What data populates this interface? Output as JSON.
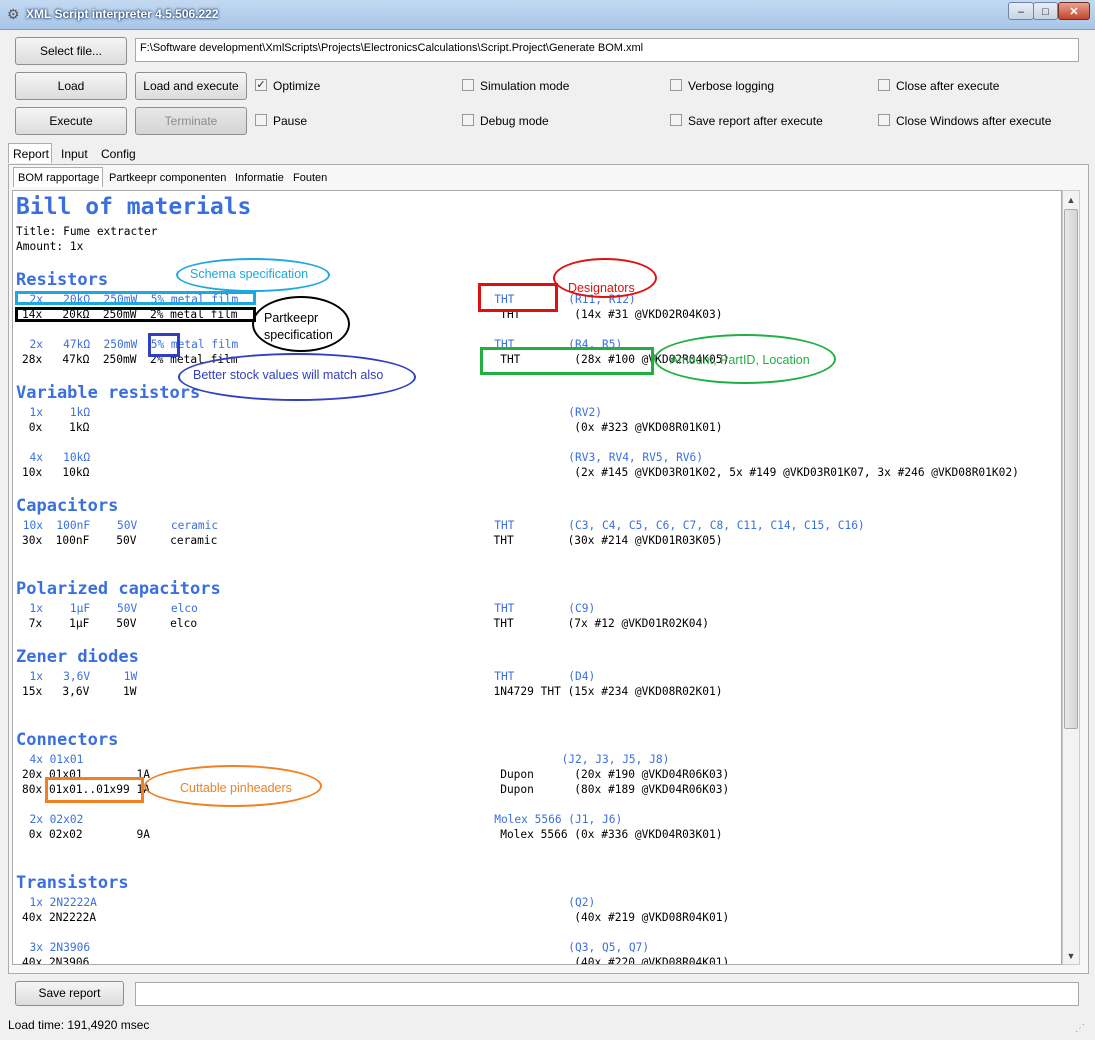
{
  "window": {
    "title": "XML Script interpreter 4.5.506.222",
    "minimize": "–",
    "maximize": "□",
    "close": "✕"
  },
  "toolbar": {
    "select_file": "Select file...",
    "file_path": "F:\\Software development\\XmlScripts\\Projects\\ElectronicsCalculations\\Script.Project\\Generate BOM.xml",
    "load": "Load",
    "load_execute": "Load and execute",
    "execute": "Execute",
    "terminate": "Terminate",
    "checkboxes": [
      {
        "label": "Optimize",
        "checked": true
      },
      {
        "label": "Simulation mode",
        "checked": false
      },
      {
        "label": "Verbose logging",
        "checked": false
      },
      {
        "label": "Close after execute",
        "checked": false
      },
      {
        "label": "Pause",
        "checked": false
      },
      {
        "label": "Debug mode",
        "checked": false
      },
      {
        "label": "Save report after execute",
        "checked": false
      },
      {
        "label": "Close Windows after execute",
        "checked": false
      }
    ]
  },
  "tabs": [
    "Report",
    "Input",
    "Config"
  ],
  "subtabs": [
    "BOM rapportage",
    "Partkeepr componenten",
    "Informatie",
    "Fouten"
  ],
  "report": {
    "title": "Bill of materials",
    "meta1": "Title: Fume extracter",
    "meta2": "Amount: 1x",
    "sections": {
      "resistors": "Resistors",
      "variable": "Variable resistors",
      "capacitors": "Capacitors",
      "polarized": "Polarized capacitors",
      "zener": "Zener diodes",
      "connectors": "Connectors",
      "transistors": "Transistors"
    },
    "lines": {
      "r1a": "  2x   20kΩ  250mW  5% metal film                                      THT        (R11, R12)",
      "r1b": "14x   20kΩ  250mW  2% metal film                                       THT        (14x #31 @VKD02R04K03)",
      "r2a": "  2x   47kΩ  250mW  5% metal film                                      THT        (R4, R5)",
      "r2b": "28x   47kΩ  250mW  2% metal film                                       THT        (28x #100 @VKD02R04K05)",
      "v1a": "  1x    1kΩ                                                                       (RV2)",
      "v1b": " 0x    1kΩ                                                                        (0x #323 @VKD08R01K01)",
      "v2a": "  4x   10kΩ                                                                       (RV3, RV4, RV5, RV6)",
      "v2b": "10x   10kΩ                                                                        (2x #145 @VKD03R01K02, 5x #149 @VKD03R01K07, 3x #246 @VKD08R01K02)",
      "c1a": " 10x  100nF    50V     ceramic                                         THT        (C3, C4, C5, C6, C7, C8, C11, C14, C15, C16)",
      "c1b": "30x  100nF    50V     ceramic                                         THT        (30x #214 @VKD01R03K05)",
      "p1a": "  1x    1µF    50V     elco                                            THT        (C9)",
      "p1b": " 7x    1µF    50V     elco                                            THT        (7x #12 @VKD01R02K04)",
      "z1a": "  1x   3,6V     1W                                                     THT        (D4)",
      "z1b": "15x   3,6V     1W                                                     1N4729 THT (15x #234 @VKD08R02K01)",
      "k1a": "  4x 01x01                                                                       (J2, J3, J5, J8)",
      "k1b": "20x 01x01        1A                                                    Dupon      (20x #190 @VKD04R06K03)",
      "k1c": "80x 01x01..01x99 1A                                                    Dupon      (80x #189 @VKD04R06K03)",
      "k2a": "  2x 02x02                                                             Molex 5566 (J1, J6)",
      "k2b": " 0x 02x02        9A                                                    Molex 5566 (0x #336 @VKD04R03K01)",
      "t1a": "  1x 2N2222A                                                                      (Q2)",
      "t1b": "40x 2N2222A                                                                       (40x #219 @VKD08R04K01)",
      "t2a": "  3x 2N3906                                                                       (Q3, Q5, Q7)",
      "t2b": "40x 2N3906                                                                        (40x #220 @VKD08R04K01)"
    }
  },
  "annotations": {
    "schema": "Schema specification",
    "partkeepr": "Partkeepr specification",
    "designators": "Designators",
    "amount": "Amount, PartID, Location",
    "better": "Better stock values will match also",
    "cuttable": "Cuttable pinheaders"
  },
  "bottom": {
    "save_report": "Save report",
    "report_path": "",
    "status": "Load time: 191,4920 msec"
  },
  "colors": {
    "report_blue": "#3a6fe0",
    "ann_cyan": "#1ea8e0",
    "ann_black": "#000000",
    "ann_red": "#e01010",
    "ann_green": "#20b040",
    "ann_blue": "#3040c0",
    "ann_orange": "#f08020"
  }
}
